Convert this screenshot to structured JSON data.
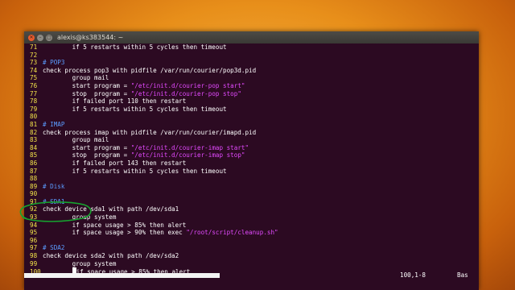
{
  "window": {
    "title": "alexis@ks383544: ~"
  },
  "icons": {
    "close": "close-icon",
    "minimize": "minimize-icon",
    "maximize": "maximize-icon"
  },
  "colors": {
    "line_number": "#f2e34a",
    "comment": "#5b9cff",
    "string": "#e34aff",
    "background": "#2c0a22"
  },
  "lines": [
    {
      "n": "71",
      "segs": [
        {
          "t": "        if 5 restarts within 5 cycles then timeout",
          "c": "txt"
        }
      ]
    },
    {
      "n": "72",
      "segs": []
    },
    {
      "n": "73",
      "segs": [
        {
          "t": "# POP3",
          "c": "cmt"
        }
      ]
    },
    {
      "n": "74",
      "segs": [
        {
          "t": "check process pop3 with pidfile /var/run/courier/pop3d.pid",
          "c": "txt"
        }
      ]
    },
    {
      "n": "75",
      "segs": [
        {
          "t": "        group mail",
          "c": "txt"
        }
      ]
    },
    {
      "n": "76",
      "segs": [
        {
          "t": "        start program = ",
          "c": "txt"
        },
        {
          "t": "\"/etc/init.d/courier-pop start\"",
          "c": "str"
        }
      ]
    },
    {
      "n": "77",
      "segs": [
        {
          "t": "        stop  program = ",
          "c": "txt"
        },
        {
          "t": "\"/etc/init.d/courier-pop stop\"",
          "c": "str"
        }
      ]
    },
    {
      "n": "78",
      "segs": [
        {
          "t": "        if failed port 110 then restart",
          "c": "txt"
        }
      ]
    },
    {
      "n": "79",
      "segs": [
        {
          "t": "        if 5 restarts within 5 cycles then timeout",
          "c": "txt"
        }
      ]
    },
    {
      "n": "80",
      "segs": []
    },
    {
      "n": "81",
      "segs": [
        {
          "t": "# IMAP",
          "c": "cmt"
        }
      ]
    },
    {
      "n": "82",
      "segs": [
        {
          "t": "check process imap with pidfile /var/run/courier/imapd.pid",
          "c": "txt"
        }
      ]
    },
    {
      "n": "83",
      "segs": [
        {
          "t": "        group mail",
          "c": "txt"
        }
      ]
    },
    {
      "n": "84",
      "segs": [
        {
          "t": "        start program = ",
          "c": "txt"
        },
        {
          "t": "\"/etc/init.d/courier-imap start\"",
          "c": "str"
        }
      ]
    },
    {
      "n": "85",
      "segs": [
        {
          "t": "        stop  program = ",
          "c": "txt"
        },
        {
          "t": "\"/etc/init.d/courier-imap stop\"",
          "c": "str"
        }
      ]
    },
    {
      "n": "86",
      "segs": [
        {
          "t": "        if failed port 143 then restart",
          "c": "txt"
        }
      ]
    },
    {
      "n": "87",
      "segs": [
        {
          "t": "        if 5 restarts within 5 cycles then timeout",
          "c": "txt"
        }
      ]
    },
    {
      "n": "88",
      "segs": []
    },
    {
      "n": "89",
      "segs": [
        {
          "t": "# Disk",
          "c": "cmt"
        }
      ]
    },
    {
      "n": "90",
      "segs": []
    },
    {
      "n": "91",
      "segs": [
        {
          "t": "# SDA1",
          "c": "cmt"
        }
      ]
    },
    {
      "n": "92",
      "segs": [
        {
          "t": "check device sda1 with path /dev/sda1",
          "c": "txt"
        }
      ]
    },
    {
      "n": "93",
      "segs": [
        {
          "t": "        group system",
          "c": "txt"
        }
      ]
    },
    {
      "n": "94",
      "segs": [
        {
          "t": "        if space usage > 85% then alert",
          "c": "txt"
        }
      ]
    },
    {
      "n": "95",
      "segs": [
        {
          "t": "        if space usage > 90% then exec ",
          "c": "txt"
        },
        {
          "t": "\"/root/script/cleanup.sh\"",
          "c": "str"
        }
      ]
    },
    {
      "n": "96",
      "segs": []
    },
    {
      "n": "97",
      "segs": [
        {
          "t": "# SDA2",
          "c": "cmt"
        }
      ]
    },
    {
      "n": "98",
      "segs": [
        {
          "t": "check device sda2 with path /dev/sda2",
          "c": "txt"
        }
      ]
    },
    {
      "n": "99",
      "segs": [
        {
          "t": "        group system",
          "c": "txt"
        }
      ]
    },
    {
      "n": "100",
      "segs": [
        {
          "t": "        ",
          "c": "txt"
        },
        {
          "t": "",
          "c": "cursor"
        },
        {
          "t": "if space usage > 85% then alert",
          "c": "txt"
        }
      ]
    }
  ],
  "status": {
    "position": "100,1-8",
    "scroll": "Bas",
    "progress": 0.43
  }
}
